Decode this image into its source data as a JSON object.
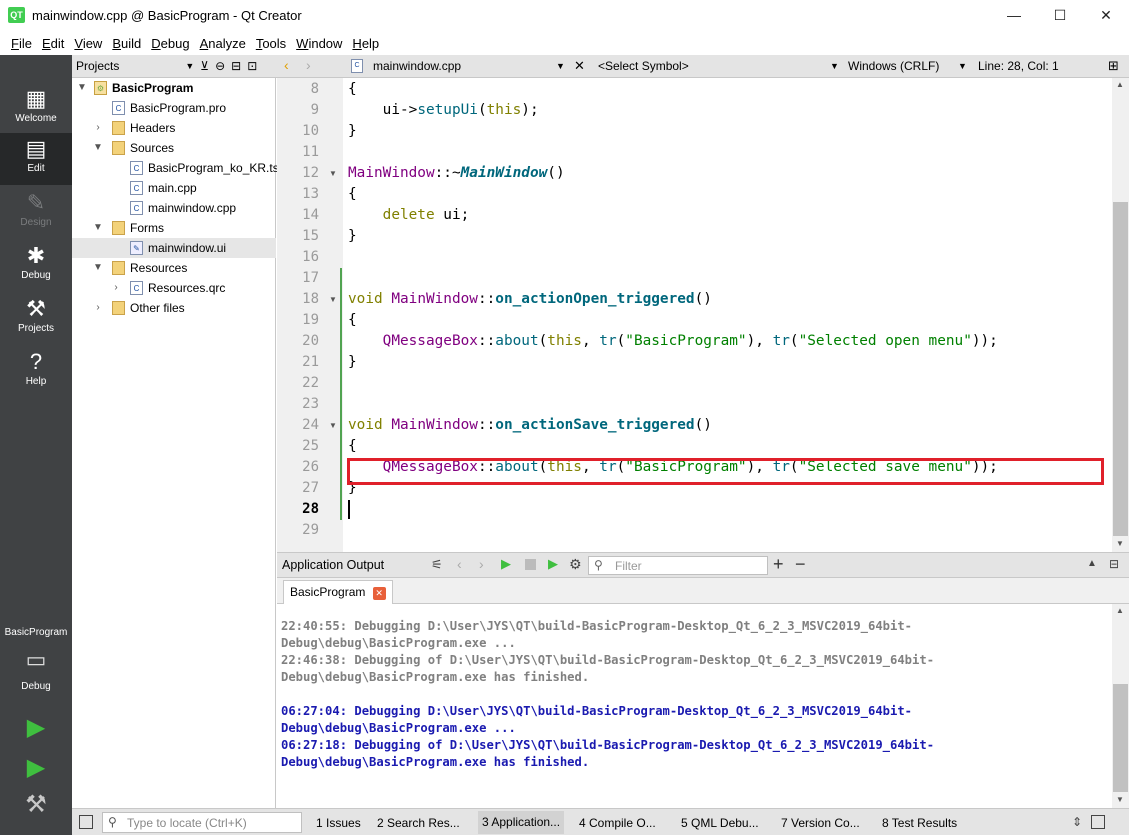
{
  "window": {
    "title": "mainwindow.cpp @ BasicProgram - Qt Creator",
    "app_icon_text": "QT",
    "controls": {
      "minimize": "—",
      "maximize": "☐",
      "close": "✕"
    }
  },
  "menu": [
    "File",
    "Edit",
    "View",
    "Build",
    "Debug",
    "Analyze",
    "Tools",
    "Window",
    "Help"
  ],
  "modes": [
    {
      "label": "Welcome",
      "icon": "grid-icon"
    },
    {
      "label": "Edit",
      "icon": "edit-document-icon",
      "active": true
    },
    {
      "label": "Design",
      "icon": "pencil-icon",
      "disabled": true
    },
    {
      "label": "Debug",
      "icon": "bug-icon"
    },
    {
      "label": "Projects",
      "icon": "wrench-icon"
    },
    {
      "label": "Help",
      "icon": "help-icon"
    }
  ],
  "kit": {
    "project": "BasicProgram",
    "config": "Debug"
  },
  "projects_panel": {
    "title": "Projects"
  },
  "tree": [
    {
      "label": "BasicProgram",
      "depth": 0,
      "icon": "proj",
      "arrow": "▼",
      "bold": true
    },
    {
      "label": "BasicProgram.pro",
      "depth": 1,
      "icon": "file"
    },
    {
      "label": "Headers",
      "depth": 1,
      "icon": "folder",
      "arrow": "›"
    },
    {
      "label": "Sources",
      "depth": 1,
      "icon": "folder",
      "arrow": "▼"
    },
    {
      "label": "BasicProgram_ko_KR.ts",
      "depth": 2,
      "icon": "file"
    },
    {
      "label": "main.cpp",
      "depth": 2,
      "icon": "file"
    },
    {
      "label": "mainwindow.cpp",
      "depth": 2,
      "icon": "file"
    },
    {
      "label": "Forms",
      "depth": 1,
      "icon": "folder",
      "arrow": "▼"
    },
    {
      "label": "mainwindow.ui",
      "depth": 2,
      "icon": "ui",
      "selected": true
    },
    {
      "label": "Resources",
      "depth": 1,
      "icon": "res",
      "arrow": "▼"
    },
    {
      "label": "Resources.qrc",
      "depth": 2,
      "icon": "file",
      "arrow": "›"
    },
    {
      "label": "Other files",
      "depth": 1,
      "icon": "folder",
      "arrow": "›"
    }
  ],
  "editor_toolbar": {
    "file": "mainwindow.cpp",
    "symbol": "<Select Symbol>",
    "encoding": "Windows (CRLF)",
    "position": "Line: 28, Col: 1"
  },
  "code_lines": [
    {
      "n": "8",
      "html": "{"
    },
    {
      "n": "9",
      "html": "    ui-><span class='fn'>setupUi</span>(<span class='kw'>this</span>);"
    },
    {
      "n": "10",
      "html": "}"
    },
    {
      "n": "11",
      "html": ""
    },
    {
      "n": "12",
      "html": "<span class='ty'>MainWindow</span>::~<span class='fni'>MainWindow</span>()",
      "fold": true
    },
    {
      "n": "13",
      "html": "{"
    },
    {
      "n": "14",
      "html": "    <span class='kw'>delete</span> ui;"
    },
    {
      "n": "15",
      "html": "}"
    },
    {
      "n": "16",
      "html": ""
    },
    {
      "n": "17",
      "html": ""
    },
    {
      "n": "18",
      "html": "<span class='kw'>void</span> <span class='ty'>MainWindow</span>::<span class='fnb'>on_actionOpen_triggered</span>()",
      "fold": true
    },
    {
      "n": "19",
      "html": "{"
    },
    {
      "n": "20",
      "html": "    <span class='ty'>QMessageBox</span>::<span class='fn'>about</span>(<span class='kw'>this</span>, <span class='fn'>tr</span>(<span class='st'>\"BasicProgram\"</span>), <span class='fn'>tr</span>(<span class='st'>\"Selected open menu\"</span>));"
    },
    {
      "n": "21",
      "html": "}"
    },
    {
      "n": "22",
      "html": ""
    },
    {
      "n": "23",
      "html": ""
    },
    {
      "n": "24",
      "html": "<span class='kw'>void</span> <span class='ty'>MainWindow</span>::<span class='fnb'>on_actionSave_triggered</span>()",
      "fold": true
    },
    {
      "n": "25",
      "html": "{"
    },
    {
      "n": "26",
      "html": "    <span class='ty'>QMessageBox</span>::<span class='fn'>about</span>(<span class='kw'>this</span>, <span class='fn'>tr</span>(<span class='st'>\"BasicProgram\"</span>), <span class='fn'>tr</span>(<span class='st'>\"Selected save menu\"</span>));"
    },
    {
      "n": "27",
      "html": "}"
    },
    {
      "n": "28",
      "html": "",
      "current": true
    },
    {
      "n": "29",
      "html": ""
    }
  ],
  "output": {
    "title": "Application Output",
    "filter_placeholder": "Filter",
    "tab": "BasicProgram",
    "lines": [
      {
        "t": "22:40:55: Debugging D:\\User\\JYS\\QT\\build-BasicProgram-Desktop_Qt_6_2_3_MSVC2019_64bit-",
        "blue": false
      },
      {
        "t": "Debug\\debug\\BasicProgram.exe ...",
        "blue": false
      },
      {
        "t": "22:46:38: Debugging of D:\\User\\JYS\\QT\\build-BasicProgram-Desktop_Qt_6_2_3_MSVC2019_64bit-",
        "blue": false
      },
      {
        "t": "Debug\\debug\\BasicProgram.exe has finished.",
        "blue": false
      },
      {
        "t": "",
        "blue": false
      },
      {
        "t": "06:27:04: Debugging D:\\User\\JYS\\QT\\build-BasicProgram-Desktop_Qt_6_2_3_MSVC2019_64bit-",
        "blue": true
      },
      {
        "t": "Debug\\debug\\BasicProgram.exe ...",
        "blue": true
      },
      {
        "t": "06:27:18: Debugging of D:\\User\\JYS\\QT\\build-BasicProgram-Desktop_Qt_6_2_3_MSVC2019_64bit-",
        "blue": true
      },
      {
        "t": "Debug\\debug\\BasicProgram.exe has finished.",
        "blue": true
      }
    ]
  },
  "statusbar": {
    "locator_placeholder": "Type to locate (Ctrl+K)",
    "panes": [
      "1  Issues",
      "2  Search Res...",
      "3  Application...",
      "4  Compile O...",
      "5  QML Debu...",
      "7  Version Co...",
      "8  Test Results"
    ],
    "current_index": 2
  },
  "colors": {
    "accent_green": "#41cd52",
    "highlight_box": "#e0202a",
    "modebar": "#404244"
  }
}
